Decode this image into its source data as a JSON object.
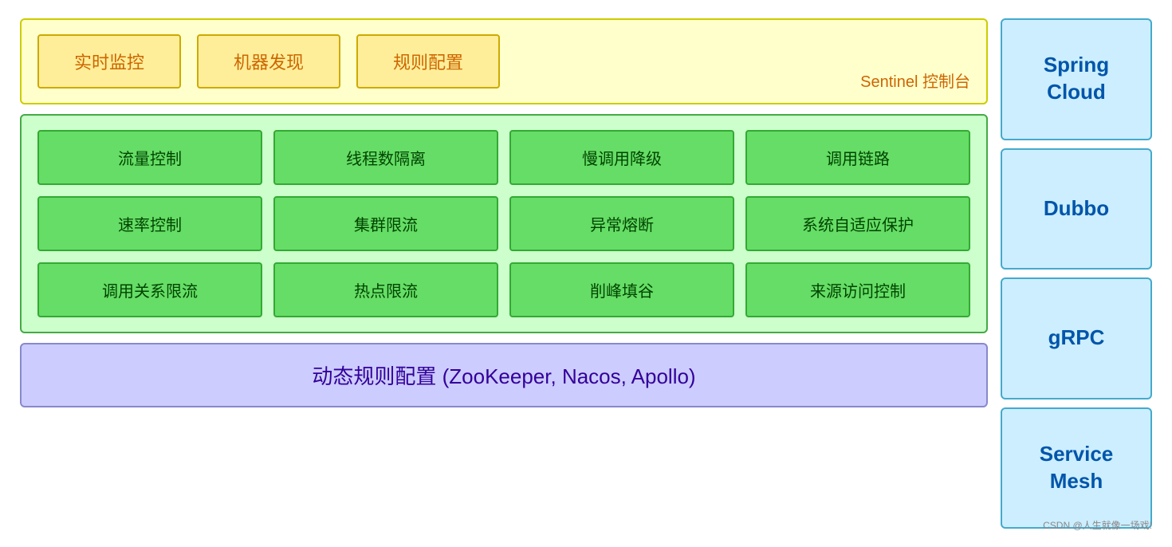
{
  "sentinel_panel": {
    "boxes": [
      "实时监控",
      "机器发现",
      "规则配置"
    ],
    "label": "Sentinel 控制台"
  },
  "features_panel": {
    "items": [
      "流量控制",
      "线程数隔离",
      "慢调用降级",
      "调用链路",
      "速率控制",
      "集群限流",
      "异常熔断",
      "系统自适应保护",
      "调用关系限流",
      "热点限流",
      "削峰填谷",
      "来源访问控制"
    ]
  },
  "dynamic_panel": {
    "text": "动态规则配置 (ZooKeeper, Nacos, Apollo)"
  },
  "sidebar": {
    "items": [
      {
        "label": "Spring\nCloud"
      },
      {
        "label": "Dubbo"
      },
      {
        "label": "gRPC"
      },
      {
        "label": "Service\nMesh"
      }
    ]
  },
  "watermark": {
    "text": "CSDN @人生就像一场戏!"
  }
}
